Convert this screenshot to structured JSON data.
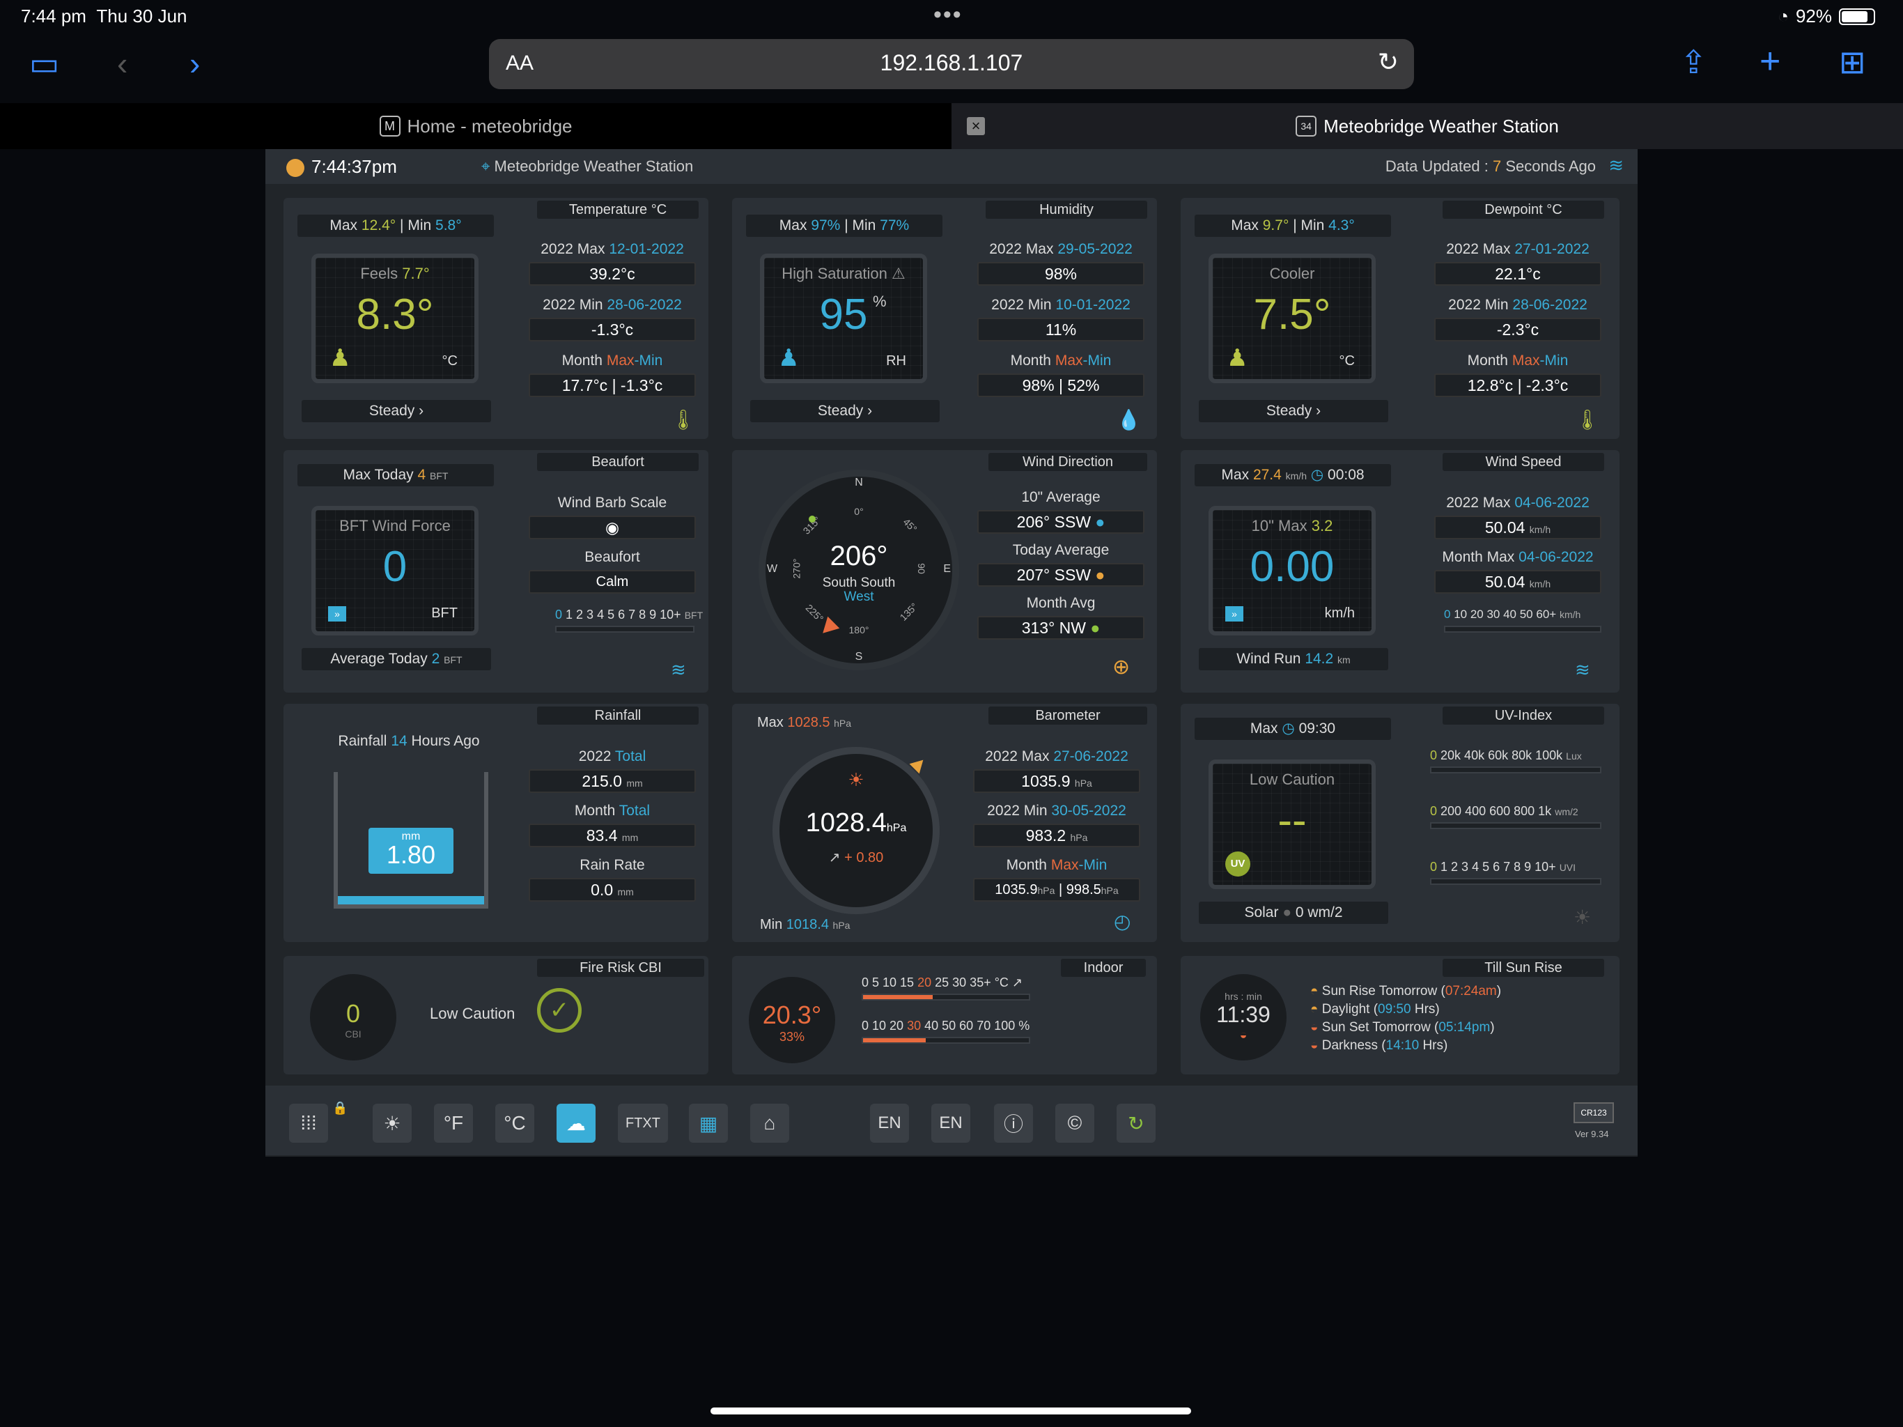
{
  "status": {
    "time": "7:44 pm",
    "date": "Thu 30 Jun",
    "battery": "92%",
    "dots": "•••"
  },
  "browser": {
    "aa": "AA",
    "url": "192.168.1.107",
    "tabs": [
      {
        "label": "Home - meteobridge",
        "favicon": "M"
      },
      {
        "label": "Meteobridge Weather Station",
        "favicon": "34"
      }
    ]
  },
  "header": {
    "time": "7:44:37pm",
    "station": "Meteobridge Weather Station",
    "updated_prefix": "Data Updated :",
    "updated_value": "7",
    "updated_suffix": "Seconds Ago"
  },
  "temperature": {
    "title": "Temperature °C",
    "max_label": "Max",
    "max": "12.4°",
    "min_label": "| Min",
    "min": "5.8°",
    "feels_label": "Feels",
    "feels": "7.7°",
    "value": "8.3°",
    "unit": "°C",
    "trend": "Steady ›",
    "year_max_label": "2022 Max",
    "year_max_date": "12-01-2022",
    "year_max": "39.2°c",
    "year_min_label": "2022 Min",
    "year_min_date": "28-06-2022",
    "year_min": "-1.3°c",
    "month_label": "Month",
    "month_max_min_a": "Max",
    "month_max_min_b": "-Min",
    "month_value": "17.7°c | -1.3°c"
  },
  "humidity": {
    "title": "Humidity",
    "max_label": "Max",
    "max": "97%",
    "min_label": "| Min",
    "min": "77%",
    "state": "High Saturation ⚠",
    "value": "95",
    "pct": "%",
    "unit": "RH",
    "trend": "Steady ›",
    "year_max_label": "2022 Max",
    "year_max_date": "29-05-2022",
    "year_max": "98%",
    "year_min_label": "2022 Min",
    "year_min_date": "10-01-2022",
    "year_min": "11%",
    "month_label": "Month",
    "month_max_min_a": "Max",
    "month_max_min_b": "-Min",
    "month_value": "98% | 52%"
  },
  "dewpoint": {
    "title": "Dewpoint °C",
    "max_label": "Max",
    "max": "9.7°",
    "min_label": "| Min",
    "min": "4.3°",
    "state": "Cooler",
    "value": "7.5°",
    "unit": "°C",
    "trend": "Steady ›",
    "year_max_label": "2022 Max",
    "year_max_date": "27-01-2022",
    "year_max": "22.1°c",
    "year_min_label": "2022 Min",
    "year_min_date": "28-06-2022",
    "year_min": "-2.3°c",
    "month_label": "Month",
    "month_max_min_a": "Max",
    "month_max_min_b": "-Min",
    "month_value": "12.8°c | -2.3°c"
  },
  "beaufort": {
    "title": "Beaufort",
    "max_today_label": "Max Today",
    "max_today": "4",
    "bft": "BFT",
    "screen_label": "BFT Wind Force",
    "value": "0",
    "unit": "BFT",
    "avg_label": "Average Today",
    "avg": "2",
    "barb_label": "Wind Barb Scale",
    "beaufort_label": "Beaufort",
    "beaufort_value": "Calm",
    "scale_first": "0",
    "scale_rest": "1 2 3 4 5 6 7 8 9 10+",
    "scale_unit": "BFT"
  },
  "wind_direction": {
    "title": "Wind Direction",
    "degrees": "206°",
    "name_a": "South South",
    "name_b": "West",
    "compass": {
      "n": "N",
      "s": "S",
      "e": "E",
      "w": "W",
      "d0": "0°",
      "d45": "45°",
      "d90": "90",
      "d135": "135°",
      "d180": "180°",
      "d225": "225°",
      "d270": "270°",
      "d315": "315°"
    },
    "avg10_label": "10\" Average",
    "avg10": "206°  SSW",
    "today_label": "Today Average",
    "today": "207°  SSW",
    "month_label": "Month Avg",
    "month": "313°  NW"
  },
  "wind_speed": {
    "title": "Wind Speed",
    "max_label": "Max",
    "max": "27.4",
    "max_unit": "km/h",
    "max_time": "00:08",
    "screen_label": "10\" Max",
    "screen_max": "3.2",
    "value": "0.00",
    "unit": "km/h",
    "run_label": "Wind Run",
    "run": "14.2",
    "run_unit": "km",
    "year_max_label": "2022 Max",
    "year_max_date": "04-06-2022",
    "year_max": "50.04",
    "month_max_label": "Month Max",
    "month_max_date": "04-06-2022",
    "month_max": "50.04",
    "scale_first": "0",
    "scale_rest": "10 20 30 40 50 60+",
    "scale_unit": "km/h"
  },
  "rainfall": {
    "title": "Rainfall",
    "ago_label": "Rainfall",
    "ago_value": "14",
    "ago_suffix": "Hours Ago",
    "unit": "mm",
    "value": "1.80",
    "year_label": "2022",
    "year_total_label": "Total",
    "year_total": "215.0",
    "month_label": "Month",
    "month_total_label": "Total",
    "month_total": "83.4",
    "rate_label": "Rain Rate",
    "rate": "0.0",
    "mm": "mm"
  },
  "barometer": {
    "title": "Barometer",
    "max_label": "Max",
    "max": "1028.5",
    "hpa": "hPa",
    "value": "1028.4",
    "trend": "+ 0.80",
    "min_label": "Min",
    "min": "1018.4",
    "year_max_label": "2022 Max",
    "year_max_date": "27-06-2022",
    "year_max": "1035.9",
    "year_min_label": "2022 Min",
    "year_min_date": "30-05-2022",
    "year_min": "983.2",
    "month_label": "Month",
    "month_max_min_a": "Max",
    "month_max_min_b": "-Min",
    "month_a": "1035.9",
    "month_b": "998.5"
  },
  "uv": {
    "title": "UV-Index",
    "max_label": "Max",
    "max_time": "09:30",
    "state": "Low Caution",
    "value": "--",
    "badge": "UV",
    "solar_label": "Solar",
    "solar": "0 wm/2",
    "lux_scale_first": "0",
    "lux_scale": "20k 40k 60k 80k 100k",
    "lux_unit": "Lux",
    "wm_scale_first": "0",
    "wm_scale": "200 400 600 800 1k",
    "wm_unit": "wm/2",
    "uvi_scale_first": "0",
    "uvi_scale": "1 2 3 4 5 6 7 8 9 10+",
    "uvi_unit": "UVI"
  },
  "fire": {
    "title": "Fire Risk CBI",
    "value": "0",
    "unit": "CBI",
    "state": "Low Caution"
  },
  "indoor": {
    "title": "Indoor",
    "temp": "20.3°",
    "humidity": "33%",
    "temp_scale_a": "0 5 10 15",
    "temp_scale_hi": "20",
    "temp_scale_b": "25 30 35+ °C",
    "hum_scale_a": "0 10 20",
    "hum_scale_hi": "30",
    "hum_scale_b": "40 50 60 70 100 %"
  },
  "sun": {
    "title": "Till Sun Rise",
    "unit": "hrs : min",
    "value": "11:39",
    "rise_label": "Sun Rise Tomorrow (",
    "rise": "07:24am",
    "day_label": "Daylight (",
    "day": "09:50",
    "day_suffix": "Hrs)",
    "set_label": "Sun Set Tomorrow (",
    "set": "05:14pm",
    "dark_label": "Darkness (",
    "dark": "14:10",
    "dark_suffix": "Hrs)"
  },
  "footer": {
    "f": "°F",
    "c": "°C",
    "ftxt": "FTXT",
    "en1": "EN",
    "en2": "EN",
    "logo": "CR123",
    "version": "Ver 9.34"
  },
  "colors": {
    "accent": "#3aaed8",
    "yellow": "#b9c546",
    "orange": "#e86b3e",
    "green": "#8fc63f",
    "panel": "#2b3036"
  }
}
